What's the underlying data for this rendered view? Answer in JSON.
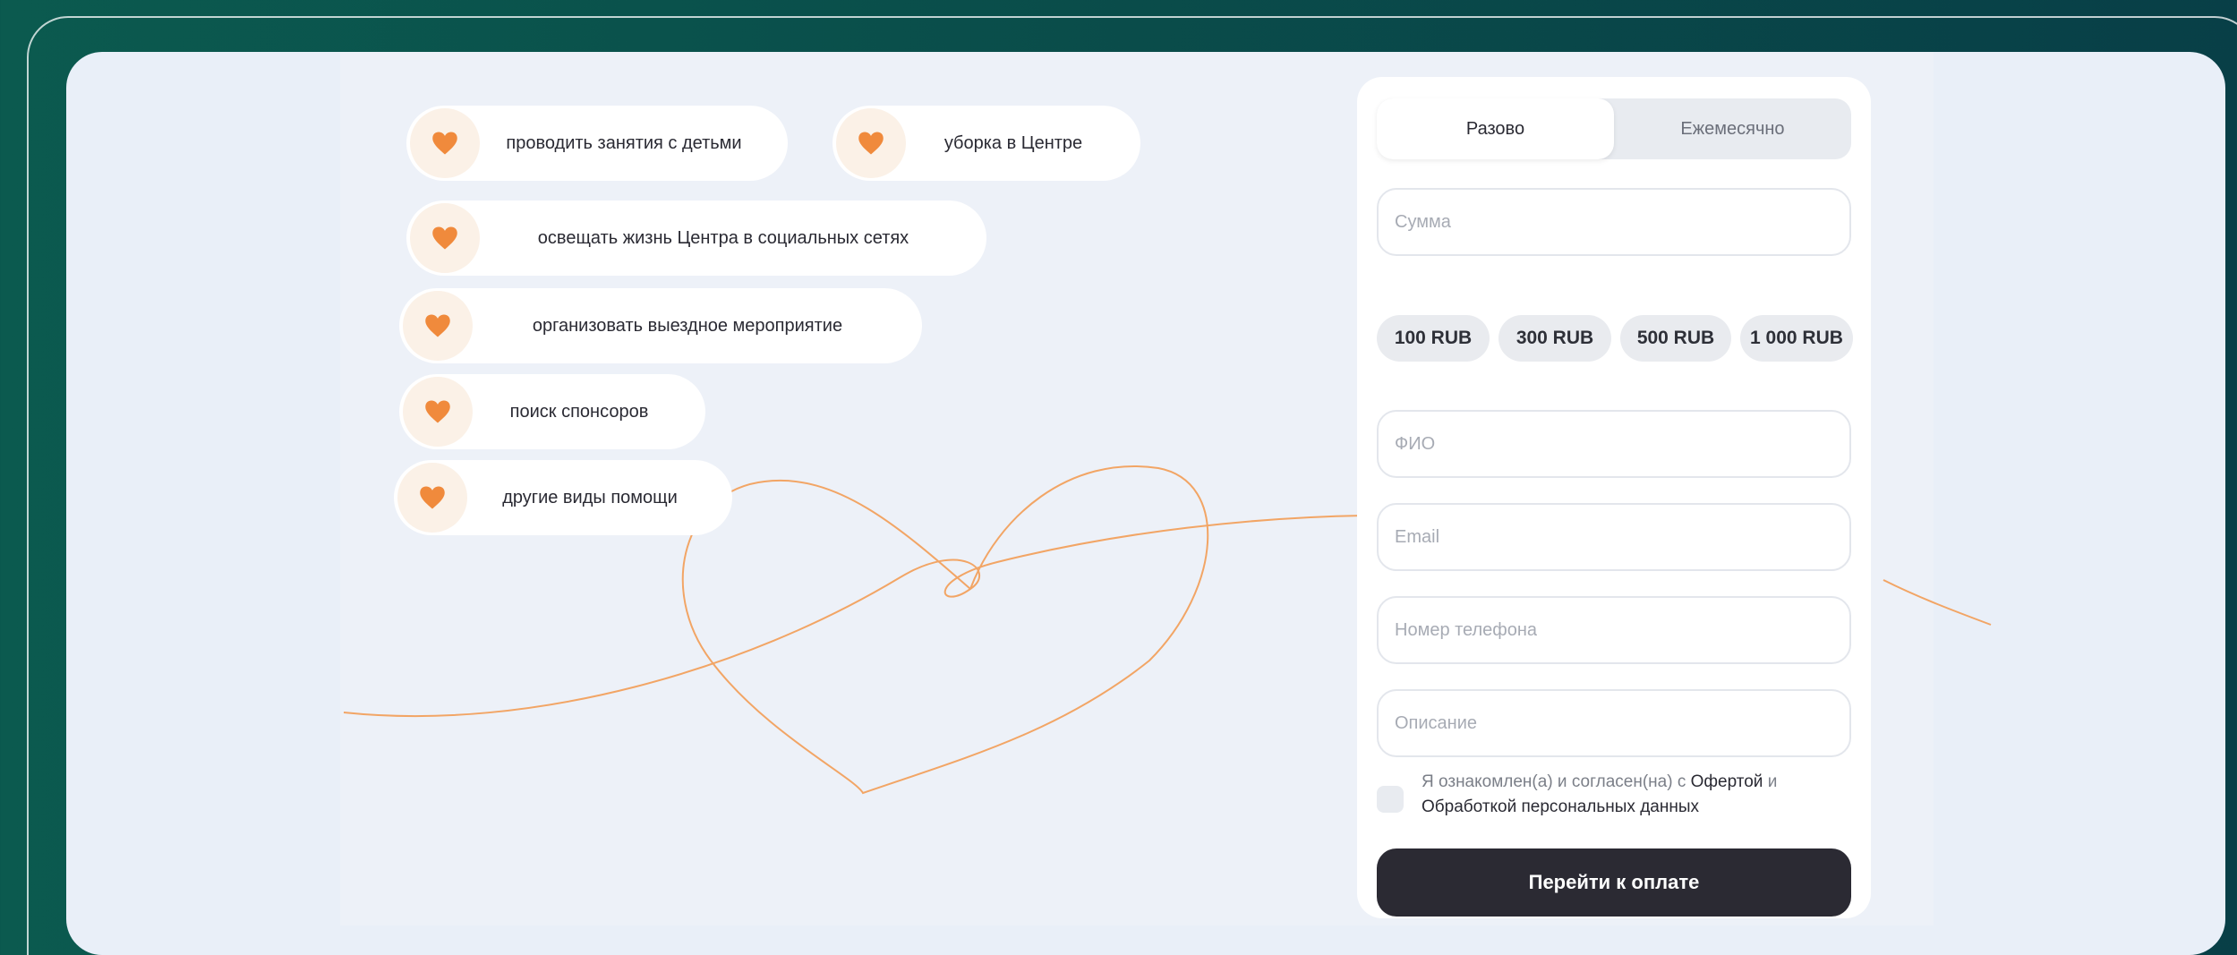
{
  "help_options": [
    {
      "label": "проводить занятия с детьми"
    },
    {
      "label": "уборка в Центре"
    },
    {
      "label": "освещать жизнь Центра в социальных сетях"
    },
    {
      "label": "организовать выездное мероприятие"
    },
    {
      "label": "поиск спонсоров"
    },
    {
      "label": "другие виды помощи"
    }
  ],
  "form": {
    "toggle": {
      "once": "Разово",
      "monthly": "Ежемесячно",
      "selected": "once"
    },
    "amount_placeholder": "Сумма",
    "presets": [
      "100 RUB",
      "300 RUB",
      "500 RUB",
      "1 000 RUB"
    ],
    "name_placeholder": "ФИО",
    "email_placeholder": "Email",
    "phone_placeholder": "Номер телефона",
    "description_placeholder": "Описание",
    "consent": {
      "prefix": "Я ознакомлен(а) и согласен(на) с",
      "offer_link": "Офертой",
      "and": "и",
      "privacy_link": "Обработкой персональных данных"
    },
    "submit": "Перейти к оплате"
  },
  "colors": {
    "accent_orange": "#f5a04a",
    "heart": "#f08a3c",
    "button_dark": "#2b2a33",
    "background_green": "#0a4f4b"
  }
}
